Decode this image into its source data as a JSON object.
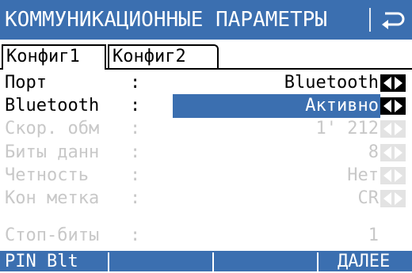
{
  "titlebar": {
    "title": "КОММУНИКАЦИОННЫЕ ПАРАМЕТРЫ",
    "back_icon": "return-arrow-icon"
  },
  "tabs": [
    {
      "label": "Конфиг1",
      "active": true
    },
    {
      "label": "Конфиг2",
      "active": false
    }
  ],
  "fields": [
    {
      "label": "Порт",
      "colon": ":",
      "value": "Bluetooth",
      "enabled": true,
      "selected": false
    },
    {
      "label": "Bluetooth",
      "colon": ":",
      "value": "Активно",
      "enabled": true,
      "selected": true
    },
    {
      "label": "Скор. обм",
      "colon": ":",
      "value": "1' 212",
      "enabled": false,
      "selected": false
    },
    {
      "label": "Биты данн",
      "colon": ":",
      "value": "8",
      "enabled": false,
      "selected": false
    },
    {
      "label": "Четность",
      "colon": ":",
      "value": "Нет",
      "enabled": false,
      "selected": false
    },
    {
      "label": "Кон метка",
      "colon": ":",
      "value": "CR",
      "enabled": false,
      "selected": false
    },
    {
      "label": "Стоп-биты",
      "colon": ":",
      "value": "1",
      "enabled": false,
      "selected": false
    }
  ],
  "footer": {
    "f1": "PIN Blt",
    "f2": "",
    "f3": "",
    "f4": "ДАЛЕЕ"
  },
  "colors": {
    "accent": "#3b6fb0",
    "disabled": "#c8c8c8",
    "text": "#000000"
  }
}
